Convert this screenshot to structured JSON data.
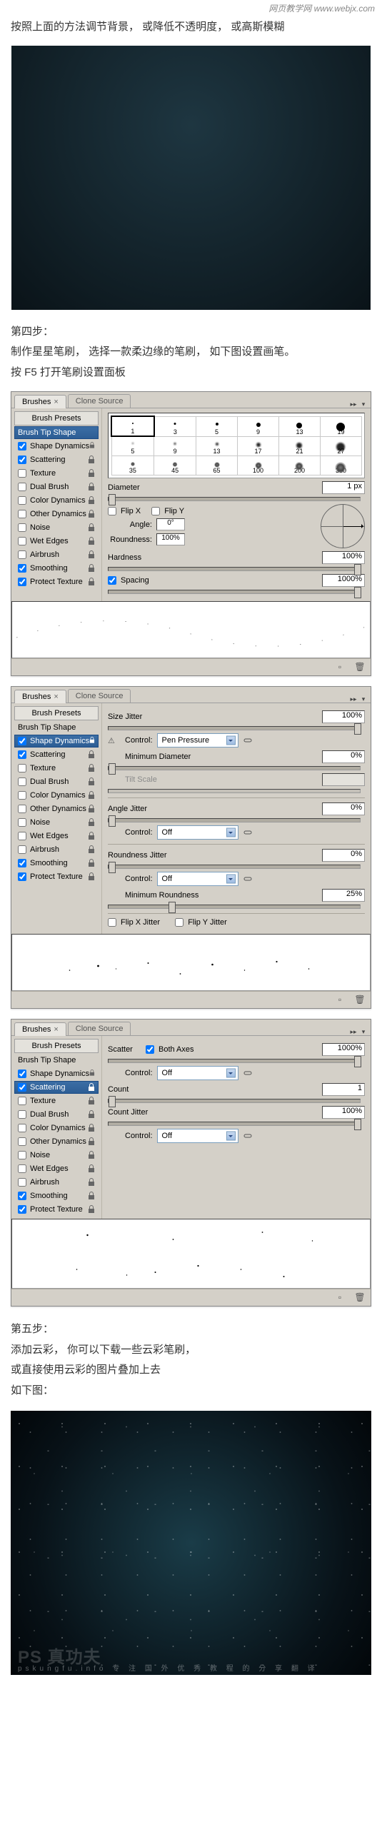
{
  "watermark_top": "网页教学网  www.webjx.com",
  "intro_line": "按照上面的方法调节背景，  或降低不透明度，  或高斯模糊",
  "step4": {
    "title": "第四步：",
    "line1": "制作星星笔刷，  选择一款柔边缘的笔刷，  如下图设置画笔。",
    "line2": "按 F5 打开笔刷设置面板"
  },
  "step5": {
    "title": "第五步：",
    "line1": "添加云彩，  你可以下载一些云彩笔刷，",
    "line2": "或直接使用云彩的图片叠加上去",
    "line3": "如下图："
  },
  "stars_wm": "PS 真功夫",
  "stars_wm_url": "pskungfu.info  专 注 国 外 优 秀 教 程 的 分 享 翻 译",
  "ps": {
    "tabs": {
      "brushes": "Brushes",
      "clone": "Clone Source"
    },
    "side": {
      "presets": "Brush Presets",
      "tip": "Brush Tip Shape",
      "shape": "Shape Dynamics",
      "scatter": "Scattering",
      "texture": "Texture",
      "dual": "Dual Brush",
      "colordyn": "Color Dynamics",
      "otherdyn": "Other Dynamics",
      "noise": "Noise",
      "wet": "Wet Edges",
      "air": "Airbrush",
      "smooth": "Smoothing",
      "protect": "Protect Texture"
    },
    "tipshape": {
      "brush_sizes": [
        "1",
        "3",
        "5",
        "9",
        "13",
        "19",
        "5",
        "9",
        "13",
        "17",
        "21",
        "27",
        "35",
        "45",
        "65",
        "100",
        "200",
        "300"
      ],
      "diameter_label": "Diameter",
      "diameter": "1 px",
      "flipx": "Flip X",
      "flipy": "Flip Y",
      "angle_label": "Angle:",
      "angle": "0°",
      "roundness_label": "Roundness:",
      "roundness": "100%",
      "hardness_label": "Hardness",
      "hardness": "100%",
      "spacing_label": "Spacing",
      "spacing": "1000%"
    },
    "shapedyn": {
      "size_jitter": "Size Jitter",
      "size_jitter_val": "100%",
      "control": "Control:",
      "control_pen": "Pen Pressure",
      "control_off": "Off",
      "min_diameter": "Minimum Diameter",
      "min_diameter_val": "0%",
      "tilt_scale": "Tilt Scale",
      "angle_jitter": "Angle Jitter",
      "angle_jitter_val": "0%",
      "roundness_jitter": "Roundness Jitter",
      "roundness_jitter_val": "0%",
      "min_roundness": "Minimum Roundness",
      "min_roundness_val": "25%",
      "flipx_jitter": "Flip X Jitter",
      "flipy_jitter": "Flip Y Jitter"
    },
    "scatter": {
      "scatter": "Scatter",
      "both_axes": "Both Axes",
      "scatter_val": "1000%",
      "control": "Control:",
      "control_off": "Off",
      "count": "Count",
      "count_val": "1",
      "count_jitter": "Count Jitter",
      "count_jitter_val": "100%"
    }
  }
}
